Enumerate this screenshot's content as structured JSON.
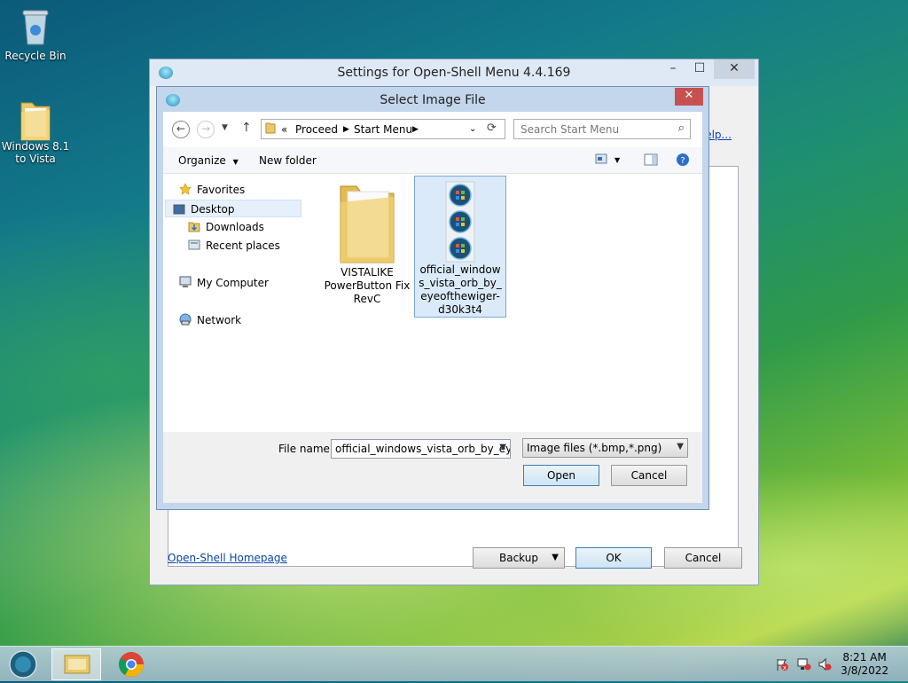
{
  "desktop": {
    "icons": [
      {
        "label": "Recycle Bin"
      },
      {
        "label": "Windows 8.1 to Vista"
      }
    ]
  },
  "settings_window": {
    "title": "Settings for Open-Shell Menu 4.4.169",
    "help_link": "elp...",
    "homepage_link": "Open-Shell Homepage",
    "backup_label": "Backup",
    "ok_label": "OK",
    "cancel_label": "Cancel"
  },
  "dialog": {
    "title": "Select Image File",
    "close_glyph": "✕",
    "address": {
      "overflow": "«",
      "crumbs": [
        "Proceed",
        "Start Menu"
      ]
    },
    "search_placeholder": "Search Start Menu",
    "toolbar": {
      "organize": "Organize",
      "new_folder": "New folder"
    },
    "nav": {
      "favorites": "Favorites",
      "desktop": "Desktop",
      "downloads": "Downloads",
      "recent": "Recent places",
      "computer": "My Computer",
      "network": "Network"
    },
    "files": [
      {
        "name": "VISTALIKE PowerButton Fix RevC"
      },
      {
        "name": "official_windows_vista_orb_by_eyeofthewiger-d30k3t4"
      }
    ],
    "file_name_label": "File name:",
    "file_name_value": "official_windows_vista_orb_by_eye",
    "file_type_value": "Image files (*.bmp,*.png)",
    "open_label": "Open",
    "cancel_label": "Cancel"
  },
  "taskbar": {
    "time": "8:21 AM",
    "date": "3/8/2022"
  },
  "colors": {
    "dialog_frame": "#c3d6ec",
    "close_red": "#c75050",
    "selection": "#dbeaf9"
  }
}
